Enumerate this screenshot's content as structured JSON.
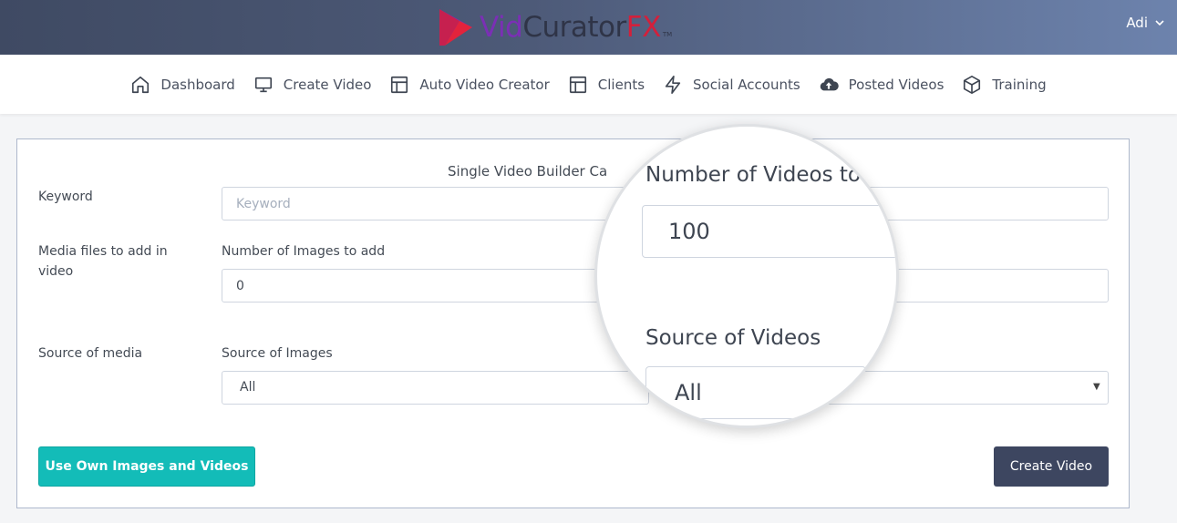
{
  "header": {
    "logo": {
      "vid": "Vid",
      "curator": "Curator",
      "fx": "FX",
      "tm": "TM"
    },
    "user": {
      "name": "Adi",
      "icon": "chevron-down-icon"
    }
  },
  "nav": {
    "items": [
      {
        "label": "Dashboard",
        "icon": "home-icon"
      },
      {
        "label": "Create Video",
        "icon": "monitor-icon"
      },
      {
        "label": "Auto Video Creator",
        "icon": "layout-icon"
      },
      {
        "label": "Clients",
        "icon": "layout-icon"
      },
      {
        "label": "Social Accounts",
        "icon": "lightning-icon"
      },
      {
        "label": "Posted Videos",
        "icon": "cloud-upload-icon"
      },
      {
        "label": "Training",
        "icon": "box-icon"
      }
    ]
  },
  "form": {
    "title": "Single Video Builder Ca",
    "keyword_label": "Keyword",
    "keyword_placeholder": "Keyword",
    "media_label": "Media files to add in video",
    "images_count_label": "Number of Images to add",
    "images_count_value": "0",
    "source_label": "Source of media",
    "source_images_label": "Source of Images",
    "source_images_value": "All",
    "use_own_button": "Use Own Images and Videos",
    "create_button": "Create Video"
  },
  "magnifier": {
    "videos_count_label": "Number of Videos to",
    "videos_count_value": "100",
    "source_videos_label": "Source of Videos",
    "source_videos_value": "All"
  },
  "colors": {
    "header_start": "#3f4a63",
    "header_end": "#6d83ad",
    "teal_button": "#13bcb8",
    "dark_button": "#3d4660",
    "card_border": "#aeb8cc"
  }
}
